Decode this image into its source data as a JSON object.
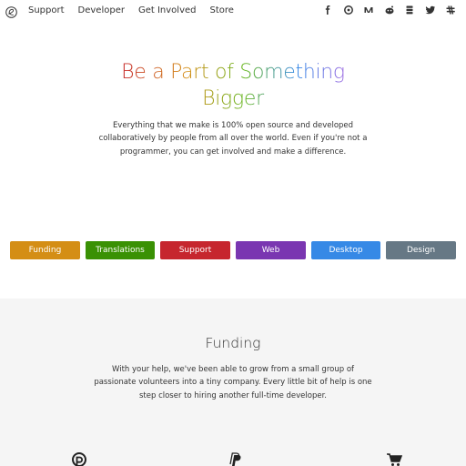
{
  "nav": {
    "links": [
      {
        "label": "Support"
      },
      {
        "label": "Developer"
      },
      {
        "label": "Get Involved"
      },
      {
        "label": "Store"
      }
    ],
    "social_icons": [
      "facebook-icon",
      "mastodon-icon",
      "medium-icon",
      "reddit-icon",
      "stack-icon",
      "twitter-icon",
      "slack-icon"
    ]
  },
  "hero": {
    "title_line1": "Be a Part of Something",
    "title_line2": "Bigger",
    "description": "Everything that we make is 100% open source and developed collaboratively by people from all over the world. Even if you're not a programmer, you can get involved and make a difference."
  },
  "tabs": [
    {
      "label": "Funding",
      "color": "#d48e15"
    },
    {
      "label": "Translations",
      "color": "#3a9104"
    },
    {
      "label": "Support",
      "color": "#c6262e"
    },
    {
      "label": "Web",
      "color": "#7a36b1"
    },
    {
      "label": "Desktop",
      "color": "#3689e6"
    },
    {
      "label": "Design",
      "color": "#667885"
    }
  ],
  "funding": {
    "title": "Funding",
    "description": "With your help, we've been able to grow from a small group of passionate volunteers into a tiny company. Every little bit of help is one step closer to hiring another full-time developer.",
    "icons": [
      "patreon-icon",
      "paypal-icon",
      "cart-icon"
    ]
  },
  "colors": {
    "title_gradient": [
      "#c6262e",
      "#d48e15",
      "#68b723",
      "#3689e6",
      "#a56de2"
    ]
  }
}
